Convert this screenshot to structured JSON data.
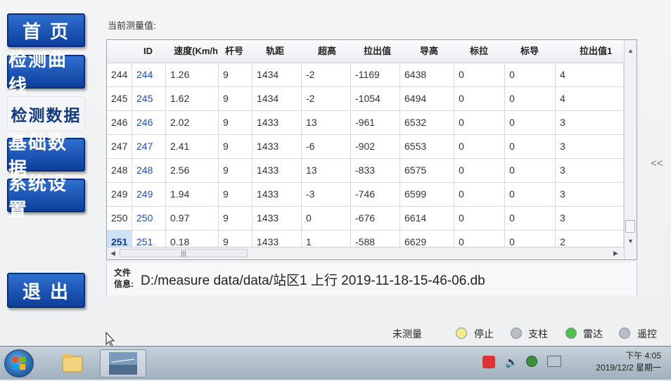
{
  "sidebar": {
    "home": "首 页",
    "curve": "检测曲线",
    "data": "检测数据",
    "base": "基础数据",
    "settings": "系统设置",
    "exit": "退 出"
  },
  "section_title": "当前测量值:",
  "table": {
    "headers": [
      "ID",
      "速度(Km/h",
      "杆号",
      "轨距",
      "超高",
      "拉出值",
      "导高",
      "标拉",
      "标导",
      "拉出值1"
    ],
    "rows": [
      {
        "num": "244",
        "id": "244",
        "speed": "1.26",
        "pole": "9",
        "gauge": "1434",
        "cant": "-2",
        "stagger": "-1169",
        "height": "6438",
        "std_stagger": "0",
        "std_height": "0",
        "stagger1": "4"
      },
      {
        "num": "245",
        "id": "245",
        "speed": "1.62",
        "pole": "9",
        "gauge": "1434",
        "cant": "-2",
        "stagger": "-1054",
        "height": "6494",
        "std_stagger": "0",
        "std_height": "0",
        "stagger1": "4"
      },
      {
        "num": "246",
        "id": "246",
        "speed": "2.02",
        "pole": "9",
        "gauge": "1433",
        "cant": "13",
        "stagger": "-961",
        "height": "6532",
        "std_stagger": "0",
        "std_height": "0",
        "stagger1": "3"
      },
      {
        "num": "247",
        "id": "247",
        "speed": "2.41",
        "pole": "9",
        "gauge": "1433",
        "cant": "-6",
        "stagger": "-902",
        "height": "6553",
        "std_stagger": "0",
        "std_height": "0",
        "stagger1": "3"
      },
      {
        "num": "248",
        "id": "248",
        "speed": "2.56",
        "pole": "9",
        "gauge": "1433",
        "cant": "13",
        "stagger": "-833",
        "height": "6575",
        "std_stagger": "0",
        "std_height": "0",
        "stagger1": "3"
      },
      {
        "num": "249",
        "id": "249",
        "speed": "1.94",
        "pole": "9",
        "gauge": "1433",
        "cant": "-3",
        "stagger": "-746",
        "height": "6599",
        "std_stagger": "0",
        "std_height": "0",
        "stagger1": "3"
      },
      {
        "num": "250",
        "id": "250",
        "speed": "0.97",
        "pole": "9",
        "gauge": "1433",
        "cant": "0",
        "stagger": "-676",
        "height": "6614",
        "std_stagger": "0",
        "std_height": "0",
        "stagger1": "3"
      },
      {
        "num": "251",
        "id": "251",
        "speed": "0.18",
        "pole": "9",
        "gauge": "1433",
        "cant": "1",
        "stagger": "-588",
        "height": "6629",
        "std_stagger": "0",
        "std_height": "0",
        "stagger1": "2"
      }
    ],
    "hscroll_grip": "|||"
  },
  "file_info": {
    "label": "文件\n信息:",
    "path": "D:/measure data/data/站区1 上行 2019-11-18-15-46-06.db"
  },
  "collapse_glyph": "<<",
  "status": {
    "unmeasured": "未测量",
    "stop": "停止",
    "pillar": "支柱",
    "radar": "雷达",
    "remote": "遥控",
    "colors": {
      "stop": "#f7ec8c",
      "pillar": "#b8bec6",
      "radar": "#4cc24c",
      "remote": "#b8bec6"
    }
  },
  "taskbar": {
    "time": "下午 4:05",
    "date": "2019/12/2 星期一"
  }
}
